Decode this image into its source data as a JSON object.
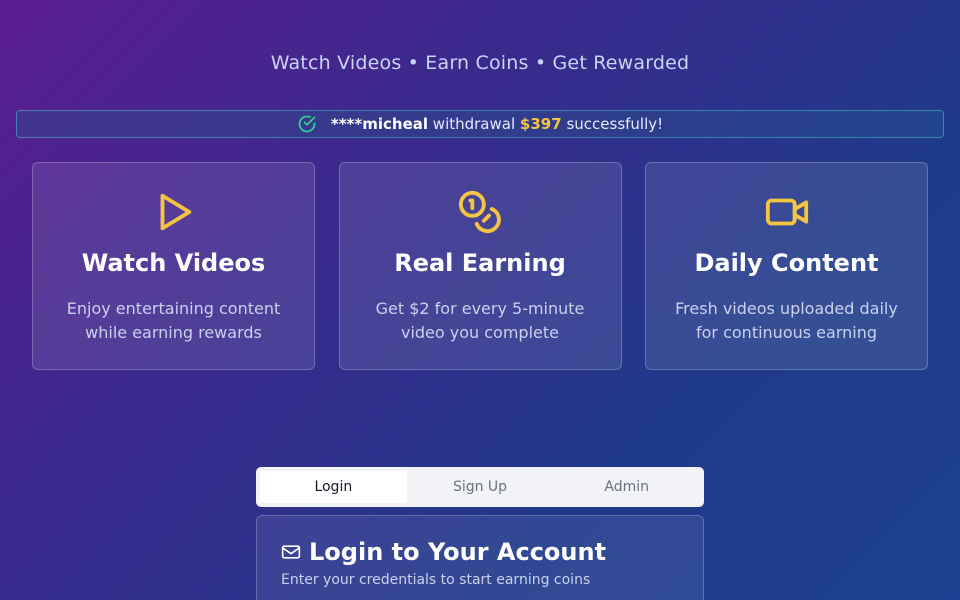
{
  "tagline": "Watch Videos • Earn Coins • Get Rewarded",
  "ticker": {
    "name": "****micheal",
    "action": "withdrawal",
    "amount": "$397",
    "suffix": "successfully!"
  },
  "features": [
    {
      "icon": "play-icon",
      "title": "Watch Videos",
      "desc": "Enjoy entertaining content while earning rewards"
    },
    {
      "icon": "coins-icon",
      "title": "Real Earning",
      "desc": "Get $2 for every 5-minute video you complete"
    },
    {
      "icon": "video-camera-icon",
      "title": "Daily Content",
      "desc": "Fresh videos uploaded daily for continuous earning"
    }
  ],
  "auth_tabs": {
    "login": "Login",
    "signup": "Sign Up",
    "admin": "Admin",
    "active": "Login"
  },
  "login_card": {
    "title": "Login to Your Account",
    "subtitle": "Enter your credentials to start earning coins"
  },
  "colors": {
    "accent": "#f5c542",
    "success": "#34d399"
  }
}
